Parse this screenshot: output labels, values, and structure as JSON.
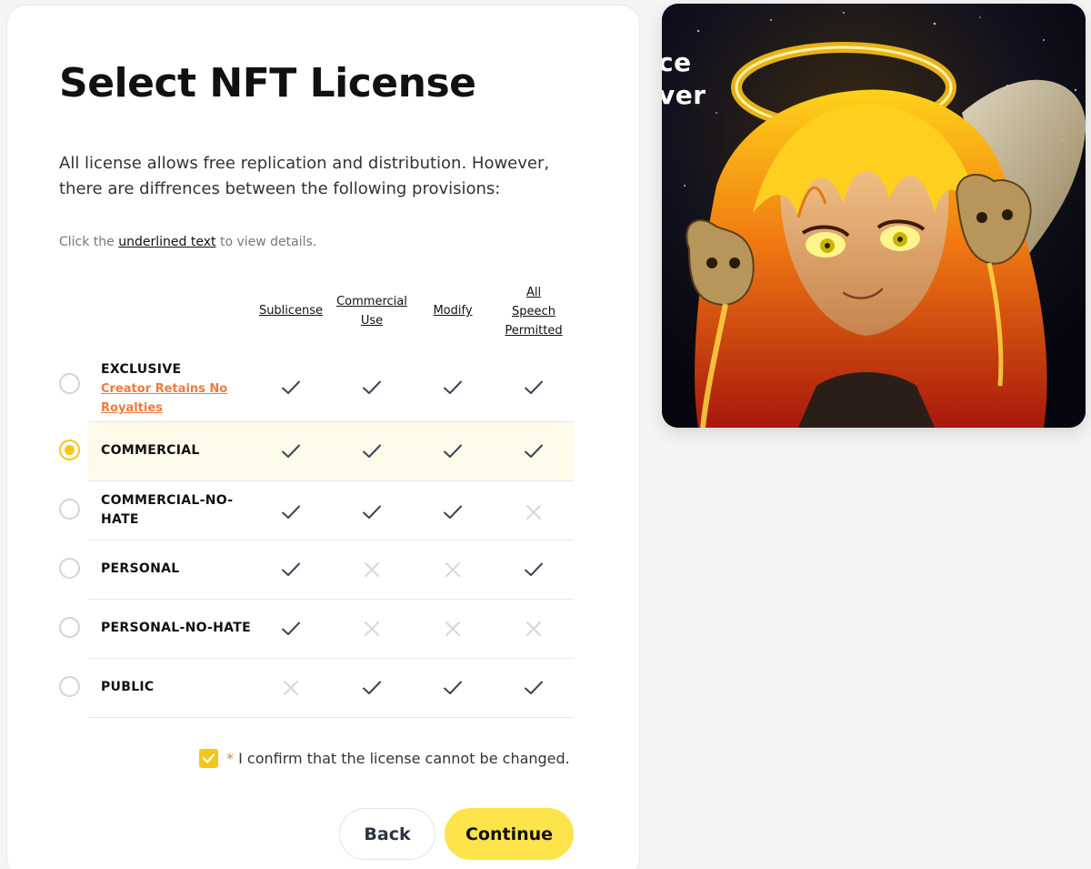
{
  "page": {
    "title": "Select NFT License",
    "intro": "All license allows free replication and distribution. However, there are diffrences between the following provisions:",
    "hint_prefix": "Click the ",
    "hint_link": "underlined text",
    "hint_suffix": " to view details."
  },
  "table": {
    "columns": [
      {
        "line1": "Sublicense"
      },
      {
        "line1": "Commercial",
        "line2": "Use"
      },
      {
        "line1": "Modify"
      },
      {
        "line1": "All",
        "line2": "Speech",
        "line3": "Permitted"
      }
    ],
    "rows": [
      {
        "label": "EXCLUSIVE",
        "sub": "Creator Retains No Royalties",
        "selected": false,
        "values": [
          true,
          true,
          true,
          true
        ]
      },
      {
        "label": "COMMERCIAL",
        "selected": true,
        "values": [
          true,
          true,
          true,
          true
        ]
      },
      {
        "label_line1": "COMMERCIAL-NO-",
        "label_line2": "HATE",
        "selected": false,
        "values": [
          true,
          true,
          true,
          false
        ]
      },
      {
        "label": "PERSONAL",
        "selected": false,
        "values": [
          true,
          false,
          false,
          true
        ]
      },
      {
        "label": "PERSONAL-NO-HATE",
        "selected": false,
        "values": [
          true,
          false,
          false,
          false
        ]
      },
      {
        "label": "PUBLIC",
        "selected": false,
        "values": [
          false,
          true,
          true,
          true
        ]
      }
    ]
  },
  "confirm": {
    "checked": true,
    "required_mark": "*",
    "text": " I confirm that the license cannot be changed."
  },
  "buttons": {
    "back": "Back",
    "continue": "Continue"
  },
  "preview": {
    "overlay_line1": "ce",
    "overlay_line2": "ver"
  },
  "colors": {
    "accent": "#fde44a",
    "radio_selected": "#f4c61a",
    "link_orange": "#f07a3a",
    "check": "#3a4556",
    "cross": "#d4d8de"
  },
  "icons": {
    "yes": "check-icon",
    "no": "cross-icon"
  }
}
